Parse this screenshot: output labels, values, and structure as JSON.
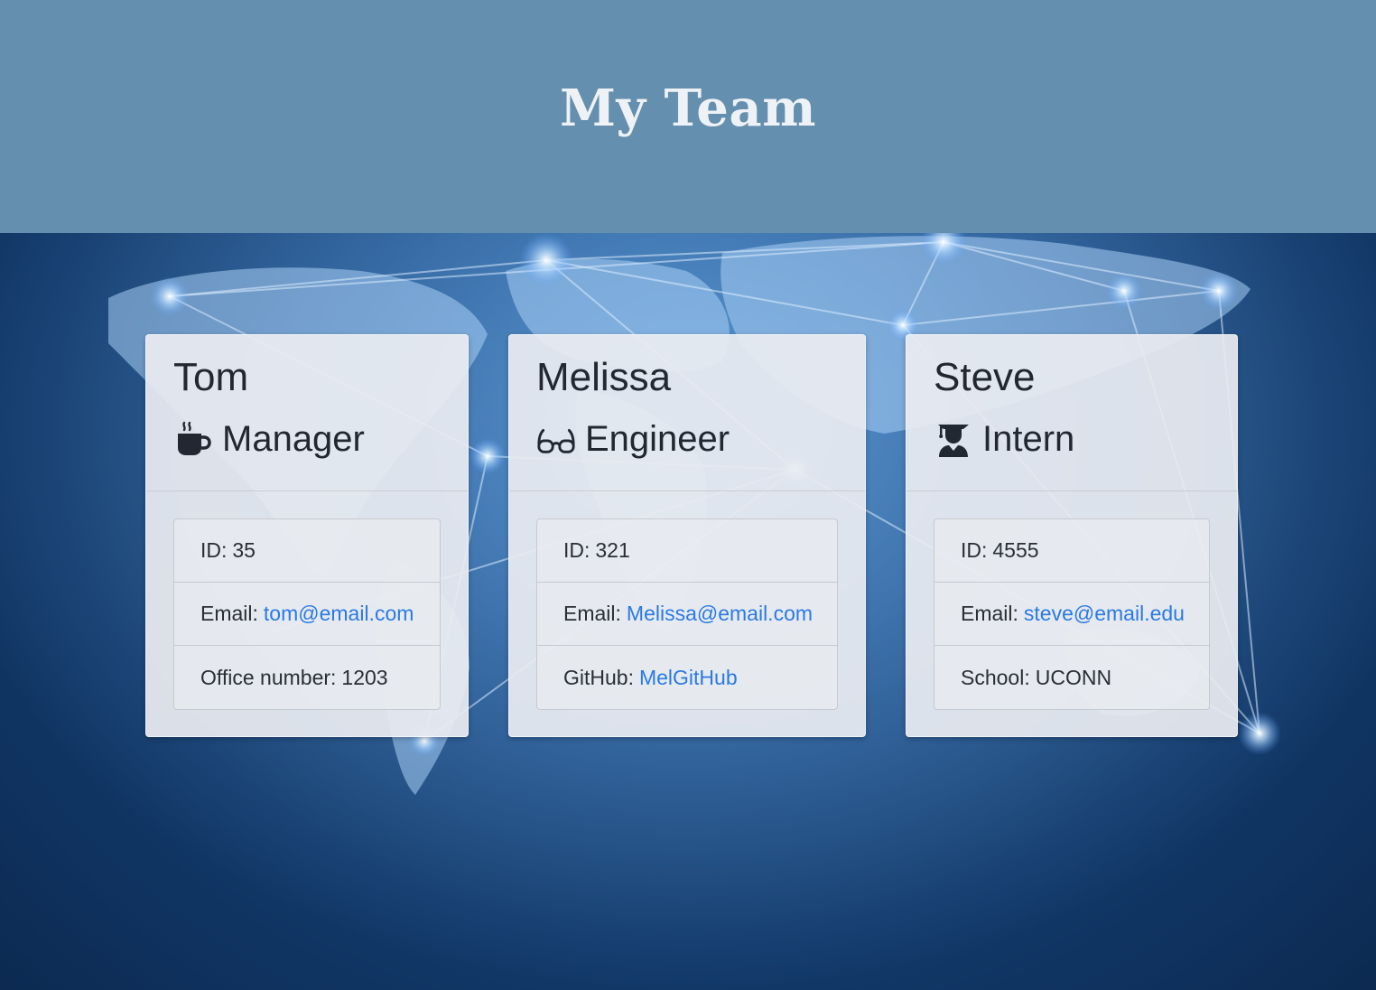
{
  "page": {
    "title": "My Team"
  },
  "colors": {
    "header_bg": "#648fae",
    "link": "#2a7ae2",
    "card_bg": "#e9ecf1",
    "background": "#123a6b"
  },
  "team": [
    {
      "name": "Tom",
      "role": "Manager",
      "icon": "coffee-mug-icon",
      "id_label": "ID:",
      "id_value": "35",
      "email_label": "Email:",
      "email_value": "tom@email.com",
      "extra_label": "Office number:",
      "extra_value": "1203"
    },
    {
      "name": "Melissa",
      "role": "Engineer",
      "icon": "glasses-icon",
      "id_label": "ID:",
      "id_value": "321",
      "email_label": "Email:",
      "email_value": "Melissa@email.com",
      "extra_label": "GitHub:",
      "extra_value": "MelGitHub"
    },
    {
      "name": "Steve",
      "role": "Intern",
      "icon": "graduate-icon",
      "id_label": "ID:",
      "id_value": "4555",
      "email_label": "Email:",
      "email_value": "steve@email.edu",
      "extra_label": "School:",
      "extra_value": "UCONN"
    }
  ]
}
